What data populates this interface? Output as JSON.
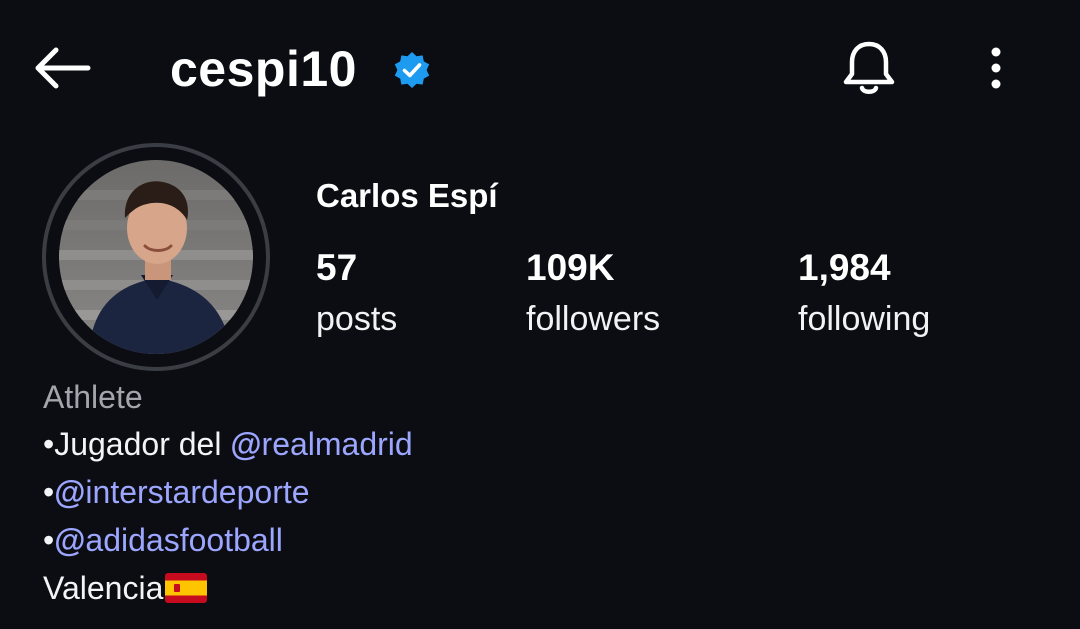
{
  "header": {
    "username": "cespi10",
    "verified": true,
    "icons": [
      "back-arrow-icon",
      "verified-badge-icon",
      "bell-icon",
      "more-vertical-icon"
    ]
  },
  "profile": {
    "full_name": "Carlos Espí",
    "stats": {
      "posts": {
        "count": "57",
        "label": "posts"
      },
      "followers": {
        "count": "109K",
        "label": "followers"
      },
      "following": {
        "count": "1,984",
        "label": "following"
      }
    }
  },
  "bio": {
    "category": "Athlete",
    "line1_prefix": "•Jugador del ",
    "line1_mention_symbol": "@",
    "line1_mention": "realmadrid",
    "line2_prefix": "•",
    "line2_mention_symbol": "@",
    "line2_mention": "interstardeporte",
    "line3_prefix": "•",
    "line3_mention_symbol": "@",
    "line3_mention": "adidasfootball",
    "location": "Valencia"
  },
  "colors": {
    "background": "#0b0d12",
    "text": "#f3f4f6",
    "muted": "#a2a5ab",
    "mention": "#9ca6ff",
    "verified": "#1d9bf0"
  }
}
